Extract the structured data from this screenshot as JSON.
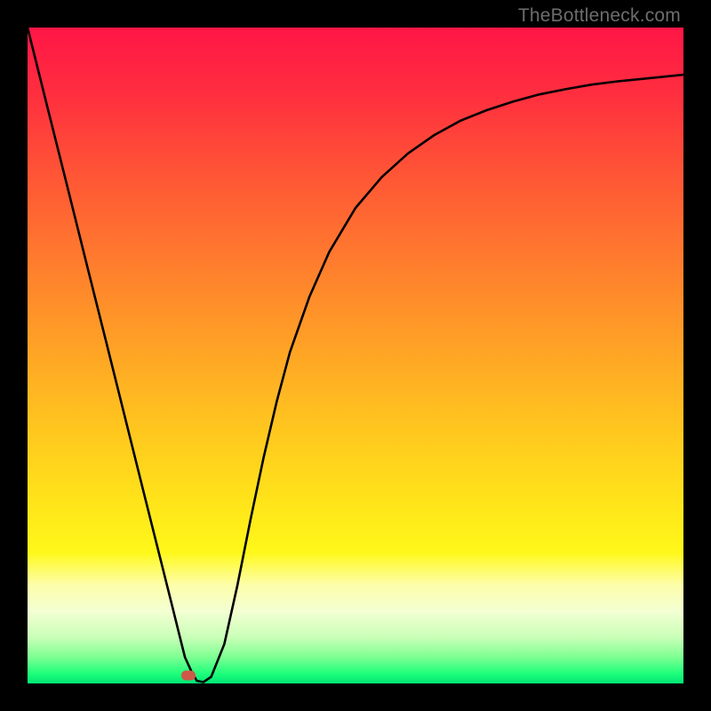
{
  "watermark": "TheBottleneck.com",
  "gradient_stops": [
    {
      "offset": 0.0,
      "color": "#ff1646"
    },
    {
      "offset": 0.1,
      "color": "#ff2e3f"
    },
    {
      "offset": 0.22,
      "color": "#ff5436"
    },
    {
      "offset": 0.35,
      "color": "#ff7a2e"
    },
    {
      "offset": 0.48,
      "color": "#ffa026"
    },
    {
      "offset": 0.6,
      "color": "#ffc31f"
    },
    {
      "offset": 0.72,
      "color": "#ffe31a"
    },
    {
      "offset": 0.8,
      "color": "#fff81a"
    },
    {
      "offset": 0.82,
      "color": "#fffb55"
    },
    {
      "offset": 0.85,
      "color": "#fdfeaa"
    },
    {
      "offset": 0.89,
      "color": "#f3ffd3"
    },
    {
      "offset": 0.93,
      "color": "#c9ffb7"
    },
    {
      "offset": 0.96,
      "color": "#7dff92"
    },
    {
      "offset": 0.985,
      "color": "#1eff7b"
    },
    {
      "offset": 1.0,
      "color": "#00e574"
    }
  ],
  "marker": {
    "x_frac": 0.245,
    "y_frac": 0.988
  },
  "chart_data": {
    "type": "line",
    "title": "",
    "xlabel": "",
    "ylabel": "",
    "xlim": [
      0,
      1
    ],
    "ylim": [
      0,
      1
    ],
    "series": [
      {
        "name": "curve",
        "x": [
          0.0,
          0.03,
          0.06,
          0.09,
          0.12,
          0.15,
          0.18,
          0.2,
          0.22,
          0.232,
          0.24,
          0.25,
          0.258,
          0.268,
          0.28,
          0.3,
          0.32,
          0.34,
          0.36,
          0.38,
          0.4,
          0.43,
          0.46,
          0.5,
          0.54,
          0.58,
          0.62,
          0.66,
          0.7,
          0.74,
          0.78,
          0.82,
          0.86,
          0.9,
          0.94,
          0.98,
          1.0
        ],
        "y": [
          1.0,
          0.88,
          0.76,
          0.64,
          0.52,
          0.4,
          0.28,
          0.2,
          0.12,
          0.072,
          0.04,
          0.018,
          0.004,
          0.002,
          0.01,
          0.06,
          0.15,
          0.25,
          0.345,
          0.43,
          0.505,
          0.59,
          0.658,
          0.725,
          0.772,
          0.808,
          0.836,
          0.858,
          0.874,
          0.887,
          0.898,
          0.906,
          0.913,
          0.918,
          0.922,
          0.926,
          0.928
        ]
      }
    ],
    "marker_point": {
      "x": 0.245,
      "y": 0.012
    }
  }
}
